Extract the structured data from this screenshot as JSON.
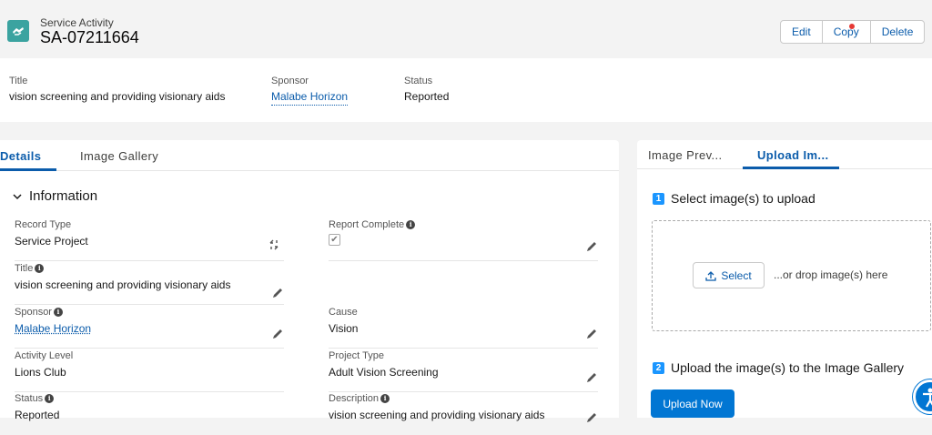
{
  "header": {
    "object_type": "Service Activity",
    "record_name": "SA-07211664",
    "actions": [
      "Edit",
      "Copy",
      "Delete"
    ]
  },
  "highlights": [
    {
      "label": "Title",
      "value": "vision screening and providing visionary aids"
    },
    {
      "label": "Sponsor",
      "value": "Malabe Horizon"
    },
    {
      "label": "Status",
      "value": "Reported"
    }
  ],
  "left_tabs": [
    "Details",
    "Image Gallery"
  ],
  "section": {
    "title": "Information"
  },
  "fields": {
    "record_type": {
      "label": "Record Type",
      "value": "Service Project"
    },
    "report_complete": {
      "label": "Report Complete",
      "value": "✔"
    },
    "title": {
      "label": "Title",
      "value": "vision screening and providing visionary aids"
    },
    "sponsor": {
      "label": "Sponsor",
      "value": "Malabe Horizon"
    },
    "cause": {
      "label": "Cause",
      "value": "Vision"
    },
    "activity_level": {
      "label": "Activity Level",
      "value": "Lions Club"
    },
    "project_type": {
      "label": "Project Type",
      "value": "Adult Vision Screening"
    },
    "status": {
      "label": "Status",
      "value": "Reported"
    },
    "description": {
      "label": "Description",
      "value": "vision screening and providing visionary aids"
    }
  },
  "right_tabs": [
    "Image Prev...",
    "Upload Im..."
  ],
  "upload": {
    "step1_num": "1",
    "step1": "Select image(s) to upload",
    "select_label": "Select",
    "drop_text": "...or drop image(s) here",
    "step2_num": "2",
    "step2": "Upload the image(s) to the Image Gallery",
    "upload_now": "Upload Now"
  },
  "colors": {
    "brand": "#0176d3",
    "link": "#0b5cab",
    "record_icon": "#3ba3a0"
  },
  "icons": [
    "service-activity-icon",
    "info-icon",
    "edit-pencil-icon",
    "change-record-type-icon",
    "chevron-down-icon",
    "upload-icon",
    "accessibility-icon"
  ]
}
